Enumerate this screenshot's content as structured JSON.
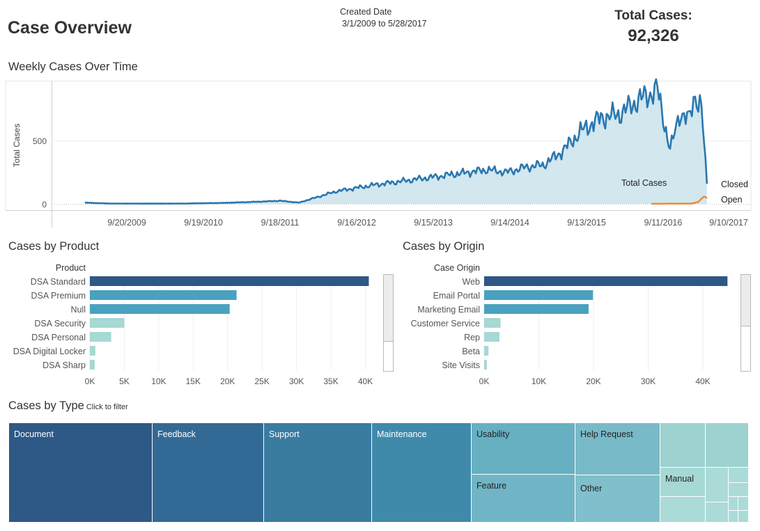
{
  "header": {
    "title": "Case Overview",
    "date_label": "Created Date",
    "date_range": "3/1/2009 to 5/28/2017",
    "total_label": "Total Cases:",
    "total_value": "92,326"
  },
  "weekly": {
    "title": "Weekly Cases Over Time",
    "ylabel": "Total Cases",
    "yticks": [
      "500",
      "0"
    ],
    "xticks": [
      "9/20/2009",
      "9/19/2010",
      "9/18/2011",
      "9/16/2012",
      "9/15/2013",
      "9/14/2014",
      "9/13/2015",
      "9/11/2016",
      "9/10/2017"
    ],
    "annotation_total": "Total Cases",
    "label_closed": "Closed",
    "label_open": "Open"
  },
  "product": {
    "title": "Cases by Product",
    "axis_header": "Product",
    "ticks": [
      "0K",
      "5K",
      "10K",
      "15K",
      "20K",
      "25K",
      "30K",
      "35K",
      "40K"
    ]
  },
  "origin": {
    "title": "Cases by Origin",
    "axis_header": "Case Origin",
    "ticks": [
      "0K",
      "10K",
      "20K",
      "30K",
      "40K"
    ]
  },
  "type": {
    "title": "Cases by Type",
    "hint": "Click to filter",
    "cells": [
      {
        "label": "Document",
        "color": "#2e5886"
      },
      {
        "label": "Feedback",
        "color": "#336a95"
      },
      {
        "label": "Support",
        "color": "#3a7ba0"
      },
      {
        "label": "Maintenance",
        "color": "#3f8aab"
      },
      {
        "label": "Usability",
        "color": "#66b0c2"
      },
      {
        "label": "Help Request",
        "color": "#79bac8"
      },
      {
        "label": "Feature",
        "color": "#70b5c5"
      },
      {
        "label": "Other",
        "color": "#80bfcb"
      },
      {
        "label": "Manual",
        "color": "#a6d8d4"
      }
    ]
  },
  "chart_data": [
    {
      "type": "area",
      "title": "Weekly Cases Over Time",
      "ylabel": "Total Cases",
      "xlabel": "",
      "ylim": [
        -20,
        990
      ],
      "x_tick_labels": [
        "9/20/2009",
        "9/19/2010",
        "9/18/2011",
        "9/16/2012",
        "9/15/2013",
        "9/14/2014",
        "9/13/2015",
        "9/11/2016",
        "9/10/2017"
      ],
      "y_tick_labels": [
        "0",
        "500"
      ],
      "grid": true,
      "series": [
        {
          "name": "Closed",
          "color": "#2a77b0",
          "x": [
            "3/1/2009",
            "7/1/2009",
            "1/1/2010",
            "7/1/2010",
            "1/1/2011",
            "7/1/2011",
            "10/1/2011",
            "1/1/2012",
            "4/1/2012",
            "7/1/2012",
            "10/1/2012",
            "1/1/2013",
            "4/1/2013",
            "7/1/2013",
            "10/1/2013",
            "1/1/2014",
            "4/1/2014",
            "7/1/2014",
            "10/1/2014",
            "1/1/2015",
            "4/1/2015",
            "7/1/2015",
            "10/1/2015",
            "1/1/2016",
            "4/1/2016",
            "7/1/2016",
            "10/1/2016",
            "12/1/2016",
            "1/15/2017",
            "3/1/2017",
            "4/1/2017",
            "5/1/2017",
            "5/28/2017"
          ],
          "values": [
            10,
            3,
            2,
            3,
            8,
            18,
            25,
            10,
            55,
            100,
            125,
            150,
            170,
            190,
            210,
            230,
            250,
            270,
            250,
            290,
            310,
            420,
            580,
            680,
            710,
            820,
            900,
            420,
            720,
            660,
            860,
            770,
            160
          ]
        },
        {
          "name": "Open",
          "color": "#f08a2c",
          "x": [
            "9/1/2016",
            "12/1/2016",
            "2/1/2017",
            "3/15/2017",
            "4/15/2017",
            "5/15/2017",
            "5/28/2017"
          ],
          "values": [
            1,
            2,
            2,
            3,
            15,
            60,
            45
          ]
        }
      ]
    },
    {
      "type": "bar",
      "title": "Cases by Product",
      "ylabel": "Product",
      "xlabel": "",
      "xlim": [
        0,
        42000
      ],
      "categories": [
        "DSA Standard",
        "DSA Premium",
        "Null",
        "DSA Security",
        "DSA Personal",
        "DSA Digital Locker",
        "DSA Sharp"
      ],
      "values": [
        40500,
        21300,
        20300,
        5000,
        3100,
        800,
        700
      ],
      "colors": [
        "#2e5886",
        "#4aa1bf",
        "#4aa1bf",
        "#a6d8d4",
        "#a6d8d4",
        "#a6d8d4",
        "#a6d8d4"
      ]
    },
    {
      "type": "bar",
      "title": "Cases by Origin",
      "ylabel": "Case Origin",
      "xlabel": "",
      "xlim": [
        0,
        46000
      ],
      "categories": [
        "Web",
        "Email Portal",
        "Marketing Email",
        "Customer Service",
        "Rep",
        "Beta",
        "Site Visits"
      ],
      "values": [
        44500,
        19900,
        19100,
        3000,
        2800,
        800,
        500
      ],
      "colors": [
        "#2e5886",
        "#4aa1bf",
        "#4aa1bf",
        "#a6d8d4",
        "#a6d8d4",
        "#a6d8d4",
        "#a6d8d4"
      ]
    }
  ]
}
